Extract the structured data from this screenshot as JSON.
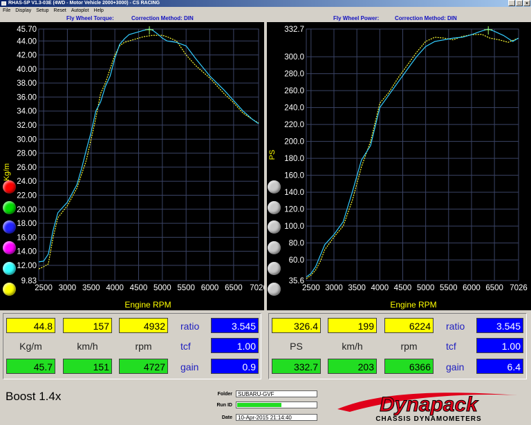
{
  "window": {
    "title": "RHAS-SP V1.3-03E  (4WD - Motor Vehicle 2000+3000) - CS RACING",
    "btn_min": "_",
    "btn_max": "□",
    "btn_close": "×"
  },
  "menu": [
    "File",
    "Display",
    "Setup",
    "Reset",
    "Autoplot",
    "Help"
  ],
  "torque_chart": {
    "title": "Fly Wheel Torque:",
    "correction": "Correction Method: DIN",
    "ylabel": "Kg/m",
    "xlabel": "Engine RPM"
  },
  "power_chart": {
    "title": "Fly Wheel Power:",
    "correction": "Correction Method: DIN",
    "ylabel": "PS",
    "xlabel": "Engine RPM"
  },
  "chart_data": [
    {
      "type": "line",
      "ylabel": "Kg/m",
      "xlabel": "Engine RPM",
      "xlim": [
        2397,
        7026
      ],
      "ylim": [
        9.83,
        45.7
      ],
      "x_ticks": [
        "2500",
        "3000",
        "3500",
        "4000",
        "4500",
        "5000",
        "5500",
        "6000",
        "6500",
        "7026"
      ],
      "y_ticks": [
        "9.83",
        "12.00",
        "14.00",
        "16.00",
        "18.00",
        "20.00",
        "22.00",
        "24.00",
        "26.00",
        "28.00",
        "30.00",
        "32.00",
        "34.00",
        "36.00",
        "38.00",
        "40.00",
        "42.00",
        "44.00",
        "45.70"
      ],
      "series": [
        {
          "color": "#ffff33",
          "x": [
            2400,
            2500,
            2600,
            2700,
            2800,
            3000,
            3200,
            3300,
            3400,
            3500,
            3600,
            3700,
            3800,
            3900,
            4000,
            4100,
            4200,
            4300,
            4400,
            4500,
            4600,
            4700,
            4800,
            4932,
            5000,
            5100,
            5300,
            5500,
            5700,
            6000,
            6300,
            6500,
            6700,
            6900,
            7026
          ],
          "y": [
            11.5,
            11.8,
            12.2,
            16,
            18.8,
            20.5,
            23,
            25,
            27,
            30,
            33,
            36.5,
            38,
            40,
            42,
            43.3,
            43.8,
            44,
            44.2,
            44.4,
            44.6,
            44.7,
            44.8,
            44.8,
            44.8,
            44.6,
            44,
            42,
            40.5,
            38.7,
            36.5,
            35.2,
            33.7,
            32.8,
            32.3
          ]
        },
        {
          "color": "#33ccff",
          "x": [
            2400,
            2500,
            2600,
            2700,
            2800,
            3000,
            3200,
            3300,
            3400,
            3500,
            3600,
            3700,
            3800,
            3900,
            4000,
            4100,
            4200,
            4300,
            4400,
            4500,
            4600,
            4727,
            4800,
            4900,
            5000,
            5100,
            5300,
            5500,
            5700,
            6000,
            6300,
            6500,
            6700,
            6900,
            7026
          ],
          "y": [
            12.5,
            12.6,
            13.6,
            17,
            19.5,
            21,
            23.5,
            25.8,
            28.5,
            31,
            34,
            35.3,
            37.5,
            39,
            41.5,
            43.5,
            44.3,
            44.9,
            45.1,
            45.3,
            45.5,
            45.7,
            45.5,
            45,
            44.4,
            44,
            43.8,
            43.3,
            41.5,
            39,
            37,
            35.5,
            34,
            32.8,
            32.2
          ]
        }
      ]
    },
    {
      "type": "line",
      "ylabel": "PS",
      "xlabel": "Engine RPM",
      "xlim": [
        2397,
        7026
      ],
      "ylim": [
        35.6,
        332.7
      ],
      "x_ticks": [
        "2500",
        "3000",
        "3500",
        "4000",
        "4500",
        "5000",
        "5500",
        "6000",
        "6500",
        "7026"
      ],
      "y_ticks": [
        "35.6",
        "60.0",
        "80.0",
        "100.0",
        "120.0",
        "140.0",
        "160.0",
        "180.0",
        "200.0",
        "220.0",
        "240.0",
        "260.0",
        "280.0",
        "300.0",
        "332.7"
      ],
      "series": [
        {
          "color": "#ffff33",
          "x": [
            2400,
            2500,
            2600,
            2700,
            2800,
            3000,
            3200,
            3400,
            3600,
            3800,
            4000,
            4200,
            4400,
            4600,
            4800,
            5000,
            5200,
            5400,
            5600,
            5800,
            6000,
            6224,
            6400,
            6600,
            6800,
            7026
          ],
          "y": [
            38,
            42,
            48,
            58,
            72,
            87,
            100,
            130,
            170,
            200,
            245,
            258,
            275,
            290,
            305,
            318,
            323,
            322,
            320,
            324,
            326,
            326.4,
            322,
            320,
            317,
            322
          ]
        },
        {
          "color": "#33ccff",
          "x": [
            2400,
            2500,
            2600,
            2700,
            2800,
            3000,
            3200,
            3400,
            3600,
            3800,
            4000,
            4200,
            4400,
            4600,
            4800,
            5000,
            5200,
            5400,
            5600,
            5800,
            6000,
            6200,
            6366,
            6500,
            6700,
            6900,
            7026
          ],
          "y": [
            40,
            44,
            52,
            65,
            78,
            90,
            105,
            140,
            178,
            195,
            240,
            255,
            270,
            285,
            300,
            312,
            318,
            320,
            322,
            323,
            326,
            330,
            332.7,
            330,
            325,
            318,
            322
          ]
        }
      ]
    }
  ],
  "readouts": {
    "left": {
      "yellow": [
        "44.8",
        "157",
        "4932"
      ],
      "units": [
        "Kg/m",
        "km/h",
        "rpm"
      ],
      "green": [
        "45.7",
        "151",
        "4727"
      ],
      "labels": [
        "ratio",
        "tcf",
        "gain"
      ],
      "blue": [
        "3.545",
        "1.00",
        "0.9"
      ]
    },
    "right": {
      "yellow": [
        "326.4",
        "199",
        "6224"
      ],
      "units": [
        "PS",
        "km/h",
        "rpm"
      ],
      "green": [
        "332.7",
        "203",
        "6366"
      ],
      "labels": [
        "ratio",
        "tcf",
        "gain"
      ],
      "blue": [
        "3.545",
        "1.00",
        "6.4"
      ]
    }
  },
  "footer": {
    "boost": "Boost 1.4x",
    "folder_label": "Folder",
    "folder_value": "SUBARU-GVF",
    "runid_label": "Run ID",
    "date_label": "Date",
    "date_value": "10-Apr-2015   21:14:40"
  },
  "logo": {
    "name": "Dynapack",
    "subtitle": "CHASSIS DYNAMOMETERS"
  },
  "colors": {
    "yellow_trace": "#ffff33",
    "cyan_trace": "#33ccff",
    "grid": "#3b4466",
    "axis_text": "#ffffff",
    "label_yellow": "#ffff00",
    "logo_red": "#e0001a"
  },
  "channel_buttons_left": [
    "red",
    "green",
    "blue",
    "magenta",
    "cyan",
    "yellow"
  ],
  "channel_colors_left": [
    "#ff0000",
    "#00dd00",
    "#2222ff",
    "#ff00ff",
    "#33ffff",
    "#ffff00"
  ]
}
